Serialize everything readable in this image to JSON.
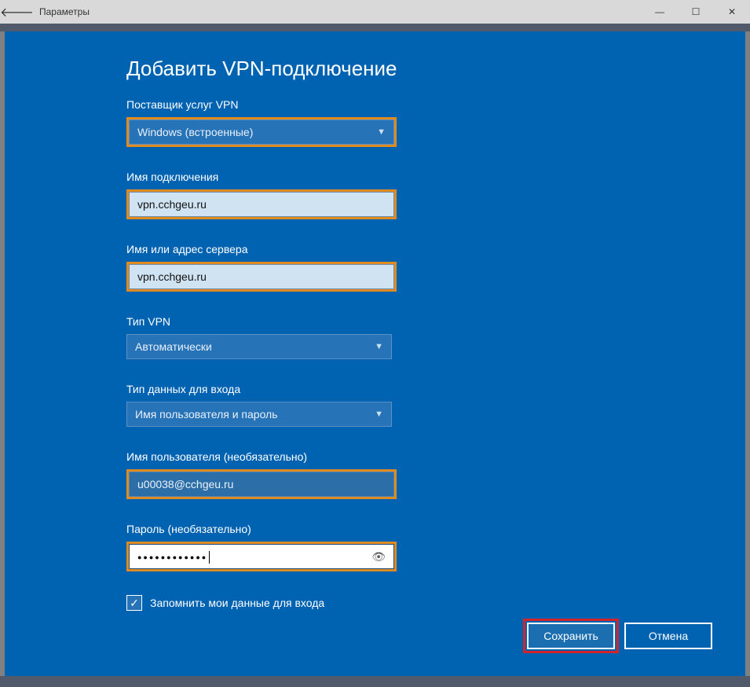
{
  "titlebar": {
    "title": "Параметры"
  },
  "page": {
    "heading": "Добавить VPN-подключение"
  },
  "fields": {
    "provider": {
      "label": "Поставщик услуг VPN",
      "value": "Windows (встроенные)"
    },
    "connName": {
      "label": "Имя подключения",
      "value": "vpn.cchgeu.ru"
    },
    "server": {
      "label": "Имя или адрес сервера",
      "value": "vpn.cchgeu.ru"
    },
    "vpnType": {
      "label": "Тип VPN",
      "value": "Автоматически"
    },
    "authType": {
      "label": "Тип данных для входа",
      "value": "Имя пользователя и пароль"
    },
    "username": {
      "label": "Имя пользователя (необязательно)",
      "value": "u00038@cchgeu.ru"
    },
    "password": {
      "label": "Пароль (необязательно)",
      "value": "●●●●●●●●●●●●"
    }
  },
  "remember": {
    "label": "Запомнить мои данные для входа",
    "checked": true
  },
  "buttons": {
    "save": "Сохранить",
    "cancel": "Отмена"
  }
}
